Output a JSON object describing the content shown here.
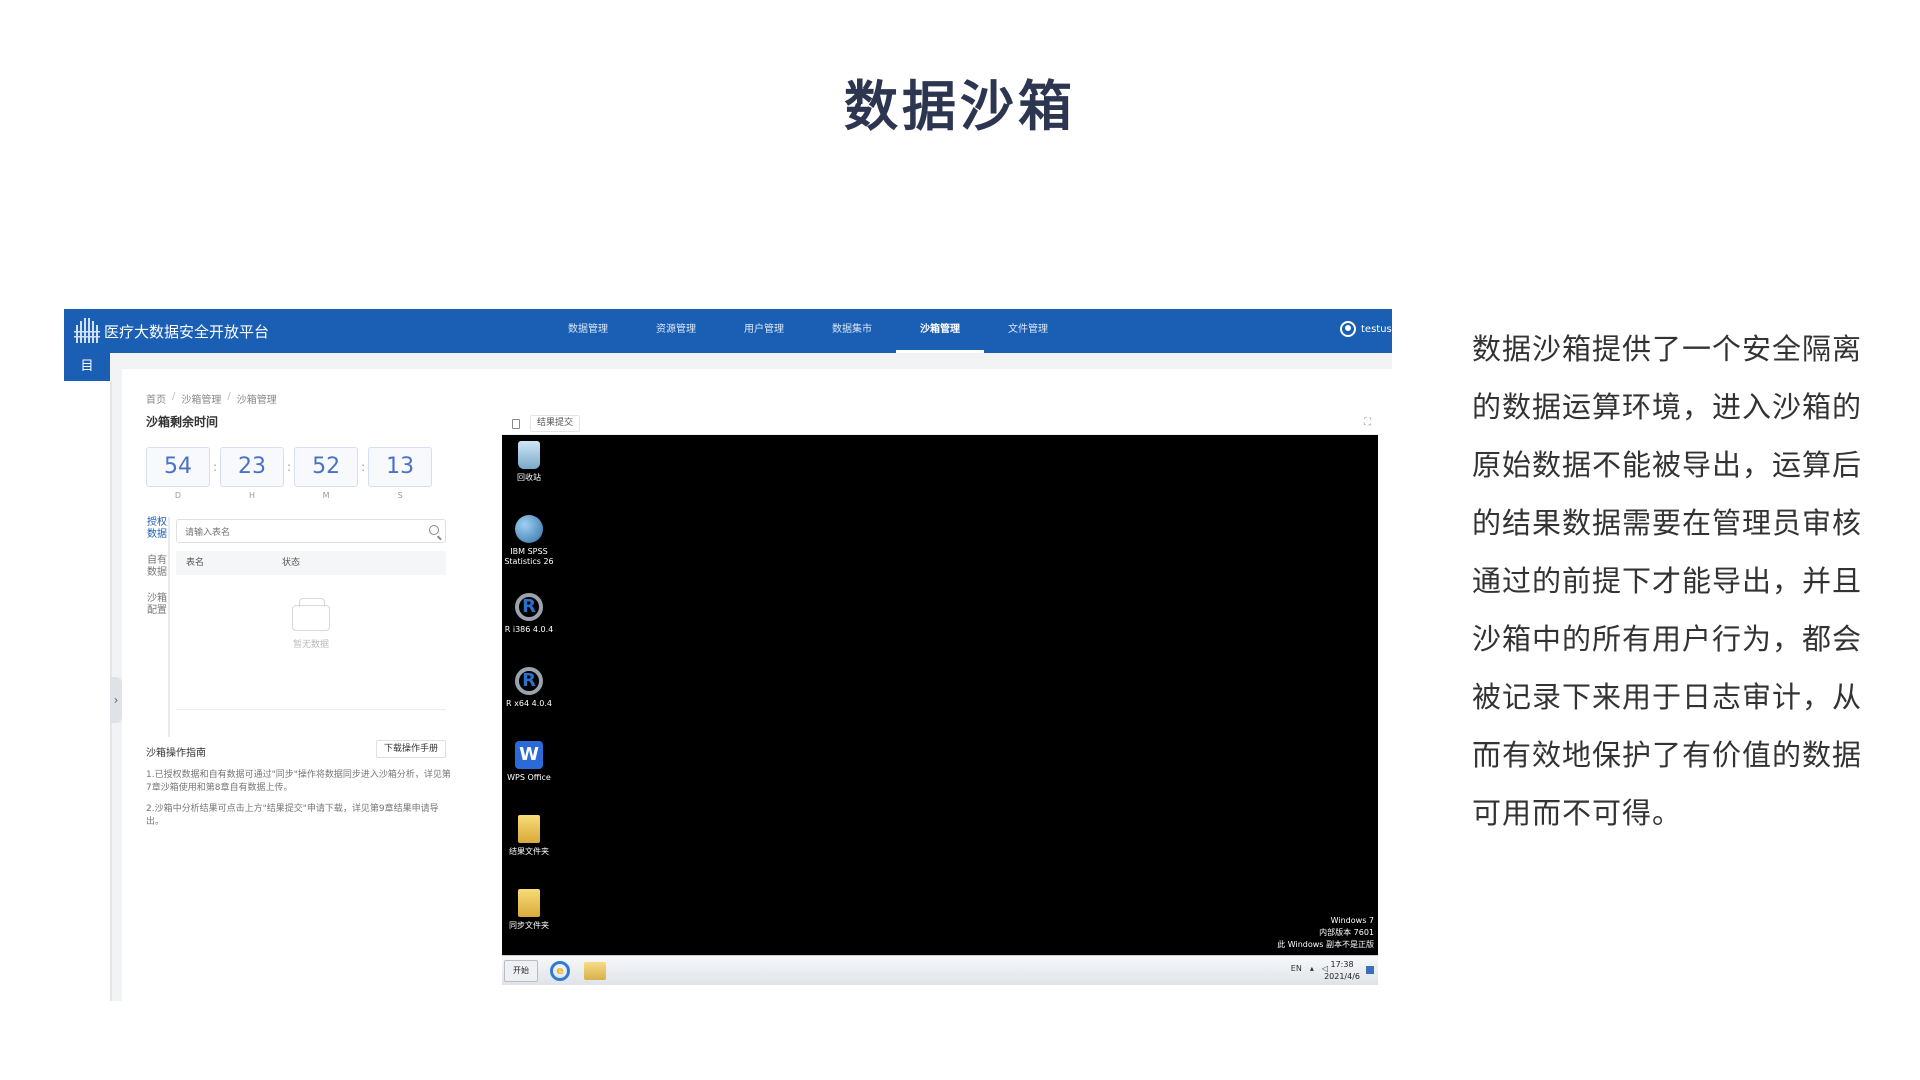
{
  "slide": {
    "title": "数据沙箱",
    "description": "数据沙箱提供了一个安全隔离的数据运算环境，进入沙箱的原始数据不能被导出，运算后的结果数据需要在管理员审核通过的前提下才能导出，并且沙箱中的所有用户行为，都会被记录下来用于日志审计，从而有效地保护了有价值的数据可用而不可得。"
  },
  "app": {
    "title": "医疗大数据安全开放平台",
    "nav": [
      "数据管理",
      "资源管理",
      "用户管理",
      "数据集市",
      "沙箱管理",
      "文件管理"
    ],
    "nav_active": "沙箱管理",
    "user": "testuse",
    "menu_toggle": "目"
  },
  "breadcrumb": [
    "首页",
    "沙箱管理",
    "沙箱管理"
  ],
  "timer": {
    "title": "沙箱剩余时间",
    "cells": [
      {
        "value": "54",
        "unit": "D"
      },
      {
        "value": "23",
        "unit": "H"
      },
      {
        "value": "52",
        "unit": "M"
      },
      {
        "value": "13",
        "unit": "S"
      }
    ]
  },
  "data_tabs": [
    "授权数据",
    "自有数据",
    "沙箱配置"
  ],
  "search": {
    "placeholder": "请输入表名",
    "value": ""
  },
  "table": {
    "columns": [
      "表名",
      "状态"
    ],
    "empty_text": "暂无数据"
  },
  "guide": {
    "title": "沙箱操作指南",
    "download_label": "下载操作手册",
    "items": [
      "1.已授权数据和自有数据可通过\"同步\"操作将数据同步进入沙箱分析，详见第7章沙箱使用和第8章自有数据上传。",
      "2.沙箱中分析结果可点击上方\"结果提交\"申请下载，详见第9章结果申请导出。"
    ]
  },
  "remote": {
    "tab_label": "结果提交",
    "desktop_icons": [
      {
        "label": "回收站",
        "icon": "recycle-bin-icon"
      },
      {
        "label": "IBM SPSS Statistics 26",
        "icon": "spss-icon"
      },
      {
        "label": "R i386 4.0.4",
        "icon": "r-icon"
      },
      {
        "label": "R x64 4.0.4",
        "icon": "r-icon"
      },
      {
        "label": "WPS Office",
        "icon": "wps-icon"
      },
      {
        "label": "结果文件夹",
        "icon": "folder-icon"
      },
      {
        "label": "同步文件夹",
        "icon": "folder-icon"
      }
    ],
    "windows_info": [
      "Windows 7",
      "内部版本 7601",
      "此 Windows 副本不是正版"
    ],
    "taskbar": {
      "start_label": "开始",
      "tray_lang": "EN",
      "time": "17:38",
      "date": "2021/4/6"
    }
  },
  "colors": {
    "brand": "#1a5fb4",
    "title": "#2d3650",
    "timer": "#4a72c4"
  }
}
